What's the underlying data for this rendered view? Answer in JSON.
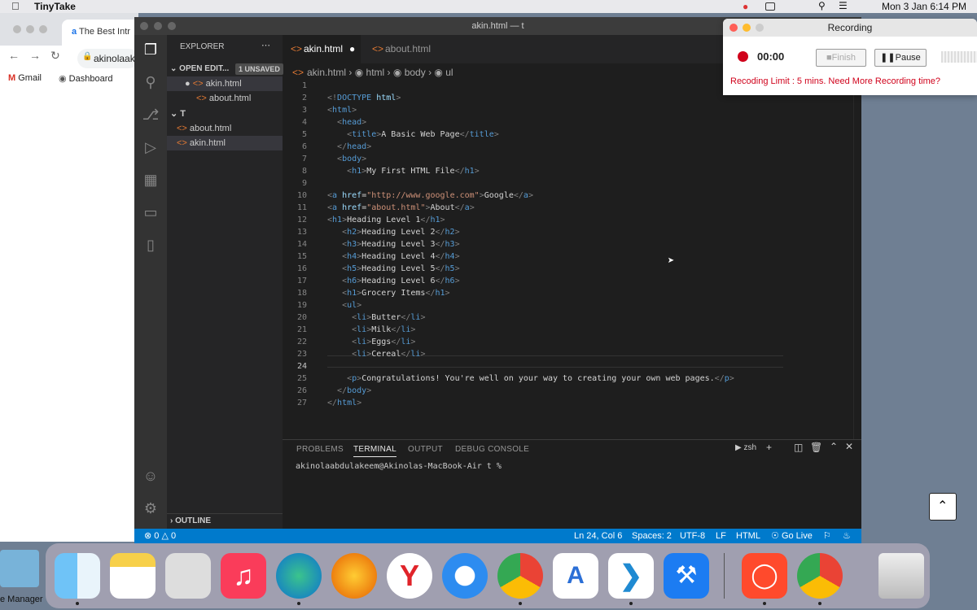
{
  "menubar": {
    "app_name": "TinyTake",
    "datetime": "Mon 3 Jan  6:14 PM"
  },
  "browser": {
    "tab_title": "The Best Intr",
    "address": "akinolaak",
    "bookmarks": [
      "Gmail",
      "Dashboard"
    ]
  },
  "vscode": {
    "window_title": "akin.html — t",
    "explorer_title": "EXPLORER",
    "open_editors": "OPEN EDIT...",
    "unsaved_badge": "1 UNSAVED",
    "open_files": [
      "akin.html",
      "about.html"
    ],
    "folder": "T",
    "folder_files": [
      "about.html",
      "akin.html"
    ],
    "outline": "OUTLINE",
    "tabs": [
      "akin.html",
      "about.html"
    ],
    "breadcrumb": [
      "akin.html",
      "html",
      "body",
      "ul"
    ],
    "line_numbers": [
      "1",
      "2",
      "3",
      "4",
      "5",
      "6",
      "7",
      "8",
      "9",
      "10",
      "11",
      "12",
      "13",
      "14",
      "15",
      "16",
      "17",
      "18",
      "19",
      "20",
      "21",
      "22",
      "23",
      "24",
      "25",
      "26",
      "27"
    ],
    "panel_tabs": [
      "PROBLEMS",
      "TERMINAL",
      "OUTPUT",
      "DEBUG CONSOLE"
    ],
    "terminal_shell": "zsh",
    "terminal_prompt": "akinolaabdulakeem@Akinolas-MacBook-Air t %",
    "status": {
      "errors": "0",
      "warnings": "0",
      "position": "Ln 24, Col 6",
      "spaces": "Spaces: 2",
      "encoding": "UTF-8",
      "eol": "LF",
      "language": "HTML",
      "live": "Go Live"
    }
  },
  "recording": {
    "title": "Recording",
    "timer": "00:00",
    "finish": "Finish",
    "pause": "Pause",
    "limit": "Recoding Limit : 5 mins. Need More Recording time?"
  },
  "dock": {
    "left_label": "e Manager"
  }
}
